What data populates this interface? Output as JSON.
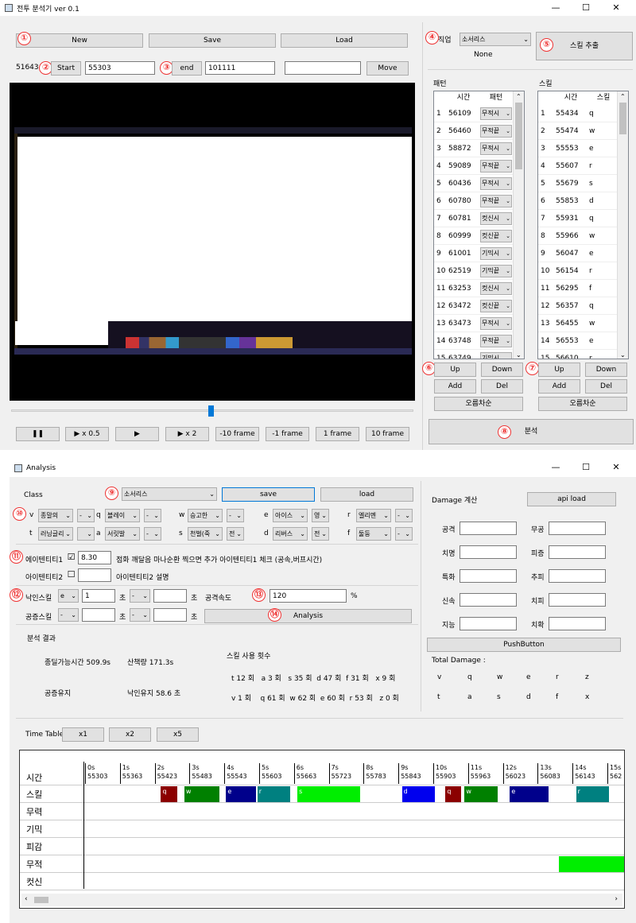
{
  "main_window": {
    "title": "전투 분석기 ver 0.1",
    "controls": {
      "minimize": "—",
      "maximize": "☐",
      "close": "✕"
    },
    "buttons": {
      "new": "New",
      "save": "Save",
      "load": "Load",
      "start": "Start",
      "end": "end",
      "move": "Move",
      "skill_extract": "스킬 추출",
      "analyze": "분석"
    },
    "frame_counter": "51643",
    "start_value": "55303",
    "end_value": "101111",
    "move_value": "",
    "job_label": "직업",
    "job_value": "소서리스",
    "none_text": "None",
    "markers": [
      "①",
      "②",
      "③",
      "④",
      "⑤",
      "⑥",
      "⑦",
      "⑧",
      "⑨",
      "⑩",
      "⑪",
      "⑫",
      "⑬",
      "⑭"
    ],
    "playback": [
      "❚❚",
      "▶ x 0.5",
      "▶",
      "▶ x 2",
      "-10 frame",
      "-1 frame",
      "1 frame",
      "10 frame"
    ],
    "video_progress": 0.5,
    "pattern": {
      "title": "패턴",
      "headers": [
        "시간",
        "패턴"
      ],
      "rows": [
        {
          "n": "1",
          "t": "56109",
          "v": "무적시"
        },
        {
          "n": "2",
          "t": "56460",
          "v": "무적끝"
        },
        {
          "n": "3",
          "t": "58872",
          "v": "무적시"
        },
        {
          "n": "4",
          "t": "59089",
          "v": "무적끝"
        },
        {
          "n": "5",
          "t": "60436",
          "v": "무적시"
        },
        {
          "n": "6",
          "t": "60780",
          "v": "무적끝"
        },
        {
          "n": "7",
          "t": "60781",
          "v": "컷신시"
        },
        {
          "n": "8",
          "t": "60999",
          "v": "컷신끝"
        },
        {
          "n": "9",
          "t": "61001",
          "v": "기믹시"
        },
        {
          "n": "10",
          "t": "62519",
          "v": "기믹끝"
        },
        {
          "n": "11",
          "t": "63253",
          "v": "컷신시"
        },
        {
          "n": "12",
          "t": "63472",
          "v": "컷신끝"
        },
        {
          "n": "13",
          "t": "63473",
          "v": "무적시"
        },
        {
          "n": "14",
          "t": "63748",
          "v": "무적끝"
        },
        {
          "n": "15",
          "t": "63749",
          "v": "기믹시"
        }
      ],
      "buttons": {
        "up": "Up",
        "down": "Down",
        "add": "Add",
        "del": "Del",
        "sort": "오름차순"
      }
    },
    "skill": {
      "title": "스킬",
      "headers": [
        "시간",
        "스킬"
      ],
      "rows": [
        {
          "n": "1",
          "t": "55434",
          "v": "q"
        },
        {
          "n": "2",
          "t": "55474",
          "v": "w"
        },
        {
          "n": "3",
          "t": "55553",
          "v": "e"
        },
        {
          "n": "4",
          "t": "55607",
          "v": "r"
        },
        {
          "n": "5",
          "t": "55679",
          "v": "s"
        },
        {
          "n": "6",
          "t": "55853",
          "v": "d"
        },
        {
          "n": "7",
          "t": "55931",
          "v": "q"
        },
        {
          "n": "8",
          "t": "55966",
          "v": "w"
        },
        {
          "n": "9",
          "t": "56047",
          "v": "e"
        },
        {
          "n": "10",
          "t": "56154",
          "v": "r"
        },
        {
          "n": "11",
          "t": "56295",
          "v": "f"
        },
        {
          "n": "12",
          "t": "56357",
          "v": "q"
        },
        {
          "n": "13",
          "t": "56455",
          "v": "w"
        },
        {
          "n": "14",
          "t": "56553",
          "v": "e"
        },
        {
          "n": "15",
          "t": "56610",
          "v": "r"
        }
      ],
      "buttons": {
        "up": "Up",
        "down": "Down",
        "add": "Add",
        "del": "Del",
        "sort": "오름차순"
      }
    }
  },
  "analysis_window": {
    "title": "Analysis",
    "class_label": "Class",
    "class_value": "소서리스",
    "save": "save",
    "load": "load",
    "skill_slots": [
      {
        "key": "v",
        "skill": "종말의",
        "lv": "-"
      },
      {
        "key": "q",
        "skill": "블레이",
        "lv": "-"
      },
      {
        "key": "w",
        "skill": "승고한",
        "lv": "-"
      },
      {
        "key": "e",
        "skill": "아이스",
        "lv": "영"
      },
      {
        "key": "r",
        "skill": "엘리멘",
        "lv": "-"
      },
      {
        "key": "t",
        "skill": "러닝글리",
        "lv": ""
      },
      {
        "key": "a",
        "skill": "서릿발",
        "lv": "-"
      },
      {
        "key": "s",
        "skill": "천벌(죽",
        "lv": "전"
      },
      {
        "key": "d",
        "skill": "리버스",
        "lv": "전"
      },
      {
        "key": "f",
        "skill": "둘둥",
        "lv": "-"
      }
    ],
    "item1": {
      "label": "에이텐티티1",
      "checked": "☑",
      "value": "8.30",
      "desc": "점화 깨달음 마나순환 찍으면 추가 아이텐티티1 체크 (공속,버프시간)"
    },
    "item2": {
      "label": "아이텐티티2",
      "checked": "☐",
      "value": "",
      "desc": "아이텐티티2 설명"
    },
    "fall_skill": {
      "label": "낙인스킬",
      "key": "e",
      "value": "1",
      "unit": "초",
      "key2": "-",
      "value2": "",
      "unit2": "초"
    },
    "air_skill": {
      "label": "공증스킬",
      "key": "-",
      "value": "",
      "unit": "초",
      "key2": "-",
      "value2": "",
      "unit2": "초"
    },
    "attack_speed": {
      "label": "공격속도",
      "value": "120",
      "unit": "%"
    },
    "analysis_button": "Analysis",
    "result": {
      "title": "분석 결과",
      "deal_time": "종딜가능시간 509.9s",
      "travel": "산책량 171.3s",
      "air_keep": "공증유지",
      "mark_keep": "낙인유지 58.6 초",
      "usage_title": "스킬 사용 횟수",
      "usage1": "t 12 회   a 3 회   s 35 회  d 47 회  f 31 회   x 9 회",
      "usage2": "v 1 회    q 61 회  w 62 회  e 60 회  r 53 회   z 0 회"
    },
    "damage": {
      "title": "Damage 계산",
      "api_load": "api load",
      "fields": [
        "공격",
        "무공",
        "치명",
        "피증",
        "특화",
        "추피",
        "신속",
        "치피",
        "지능",
        "치확"
      ],
      "push_button": "PushButton",
      "total_label": "Total Damage :",
      "keys_row1": [
        "v",
        "q",
        "w",
        "e",
        "r",
        "z"
      ],
      "keys_row2": [
        "t",
        "a",
        "s",
        "d",
        "f",
        "x"
      ]
    },
    "timetable": {
      "label": "Time Table",
      "zoom": [
        "x1",
        "x2",
        "x5"
      ],
      "row_labels": [
        "시간",
        "스킬",
        "무력",
        "기믹",
        "피감",
        "무적",
        "컷신"
      ],
      "ticks": [
        {
          "s": "0s",
          "f": "55303"
        },
        {
          "s": "1s",
          "f": "55363"
        },
        {
          "s": "2s",
          "f": "55423"
        },
        {
          "s": "3s",
          "f": "55483"
        },
        {
          "s": "4s",
          "f": "55543"
        },
        {
          "s": "5s",
          "f": "55603"
        },
        {
          "s": "6s",
          "f": "55663"
        },
        {
          "s": "7s",
          "f": "55723"
        },
        {
          "s": "8s",
          "f": "55783"
        },
        {
          "s": "9s",
          "f": "55843"
        },
        {
          "s": "10s",
          "f": "55903"
        },
        {
          "s": "11s",
          "f": "55963"
        },
        {
          "s": "12s",
          "f": "56023"
        },
        {
          "s": "13s",
          "f": "56083"
        },
        {
          "s": "14s",
          "f": "56143"
        },
        {
          "s": "15s",
          "f": "562"
        }
      ],
      "skill_blocks": [
        {
          "label": "q",
          "start": 2.18,
          "end": 2.65,
          "color": "#8b0000"
        },
        {
          "label": "w",
          "start": 2.85,
          "end": 3.85,
          "color": "#008000"
        },
        {
          "label": "e",
          "start": 4.05,
          "end": 4.9,
          "color": "#00008b"
        },
        {
          "label": "r",
          "start": 4.95,
          "end": 5.9,
          "color": "#008080"
        },
        {
          "label": "s",
          "start": 6.1,
          "end": 7.9,
          "color": "#00ee00"
        },
        {
          "label": "d",
          "start": 9.1,
          "end": 10.05,
          "color": "#0000ee"
        },
        {
          "label": "q",
          "start": 10.35,
          "end": 10.8,
          "color": "#8b0000"
        },
        {
          "label": "w",
          "start": 10.9,
          "end": 11.85,
          "color": "#008000"
        },
        {
          "label": "e",
          "start": 12.2,
          "end": 13.3,
          "color": "#00008b"
        },
        {
          "label": "r",
          "start": 14.1,
          "end": 15.05,
          "color": "#008080"
        }
      ],
      "invincible_blocks": [
        {
          "start": 13.6,
          "end": 15.6,
          "color": "#00ee00"
        }
      ]
    }
  }
}
